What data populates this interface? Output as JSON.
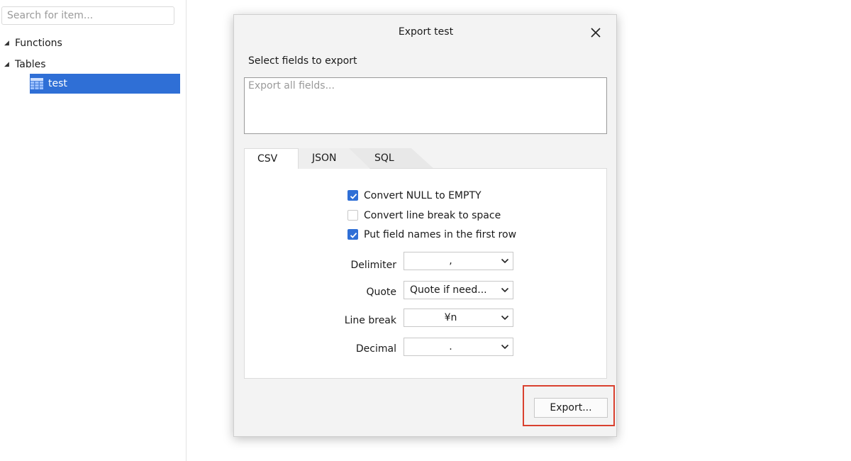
{
  "sidebar": {
    "search_placeholder": "Search for item...",
    "tree": [
      {
        "label": "Functions",
        "expanded": true
      },
      {
        "label": "Tables",
        "expanded": true
      }
    ],
    "selected_item": "test"
  },
  "dialog": {
    "title": "Export test",
    "fields_label": "Select fields to export",
    "fields_placeholder": "Export all fields...",
    "tabs": [
      "CSV",
      "JSON",
      "SQL"
    ],
    "active_tab": "CSV",
    "checkboxes": [
      {
        "label": "Convert NULL to EMPTY",
        "checked": true
      },
      {
        "label": "Convert line break to space",
        "checked": false
      },
      {
        "label": "Put field names in the first row",
        "checked": true
      }
    ],
    "options": [
      {
        "label": "Delimiter",
        "value": ","
      },
      {
        "label": "Quote",
        "value": "Quote if need..."
      },
      {
        "label": "Line break",
        "value": "¥n"
      },
      {
        "label": "Decimal",
        "value": "."
      }
    ],
    "export_button": "Export..."
  },
  "colors": {
    "selection": "#2f6fd6",
    "highlight_box": "#d9412f",
    "dialog_bg": "#f3f3f3"
  }
}
